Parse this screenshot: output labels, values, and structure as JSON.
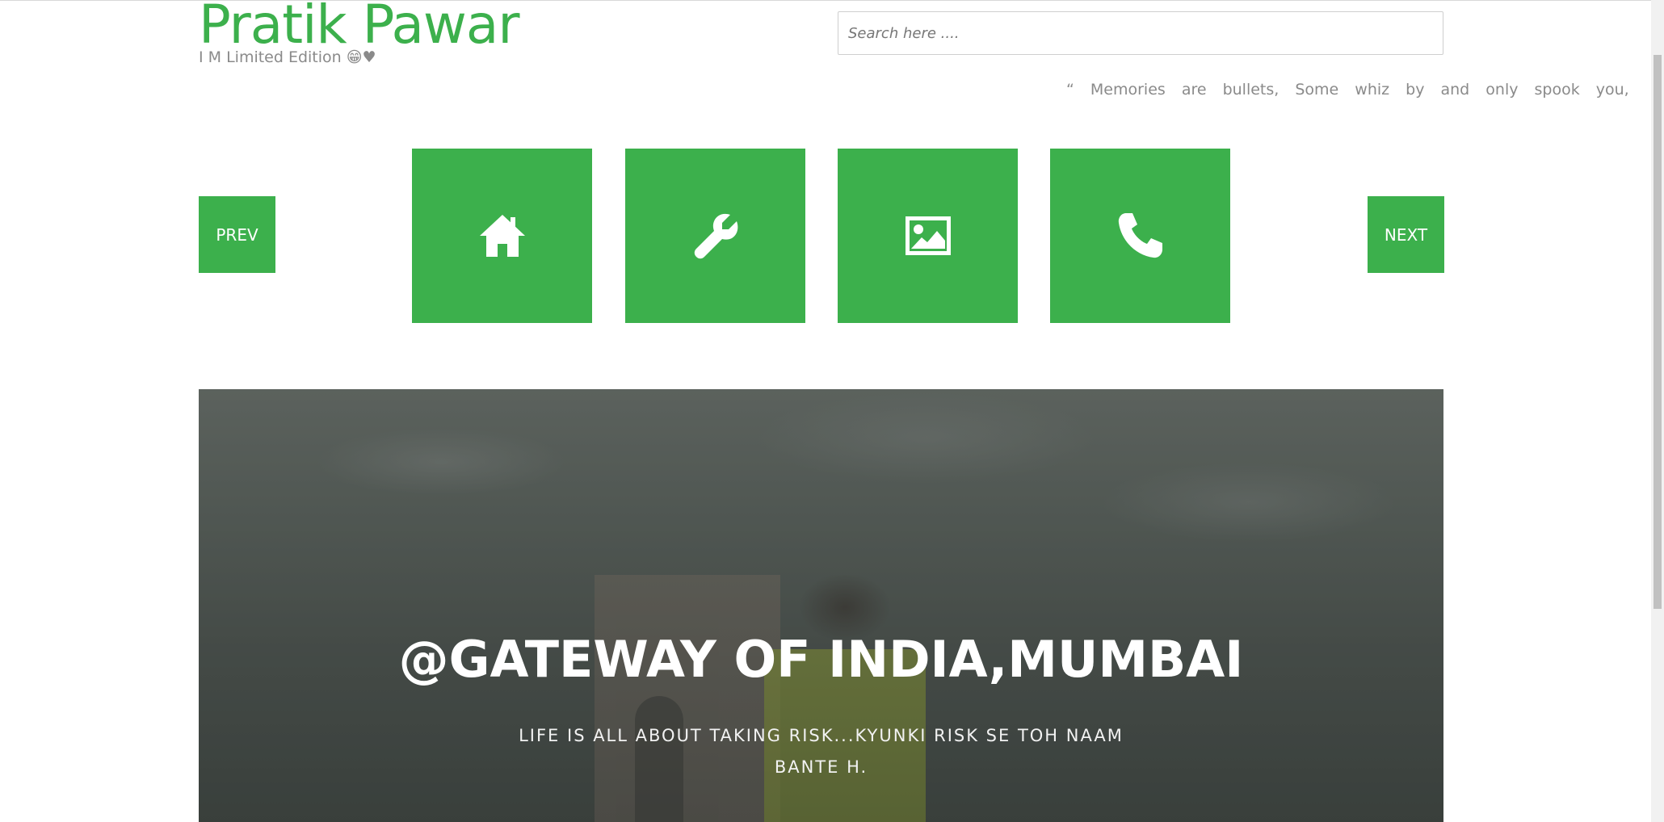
{
  "header": {
    "title": "Pratik Pawar",
    "tagline": "I M Limited Edition 😁♥"
  },
  "search": {
    "placeholder": "Search here ...."
  },
  "quote": {
    "text": "“ Memories are bullets, Some whiz by and only spook you, Others"
  },
  "nav": {
    "prev_label": "PREV",
    "next_label": "NEXT",
    "tiles": [
      {
        "icon": "home-icon"
      },
      {
        "icon": "wrench-icon"
      },
      {
        "icon": "image-icon"
      },
      {
        "icon": "phone-icon"
      }
    ]
  },
  "hero": {
    "title": "@GATEWAY OF INDIA,MUMBAI",
    "subtitle": "LIFE IS ALL ABOUT TAKING RISK...KYUNKI RISK SE TOH NAAM BANTE H."
  },
  "colors": {
    "accent": "#3cb04c"
  }
}
